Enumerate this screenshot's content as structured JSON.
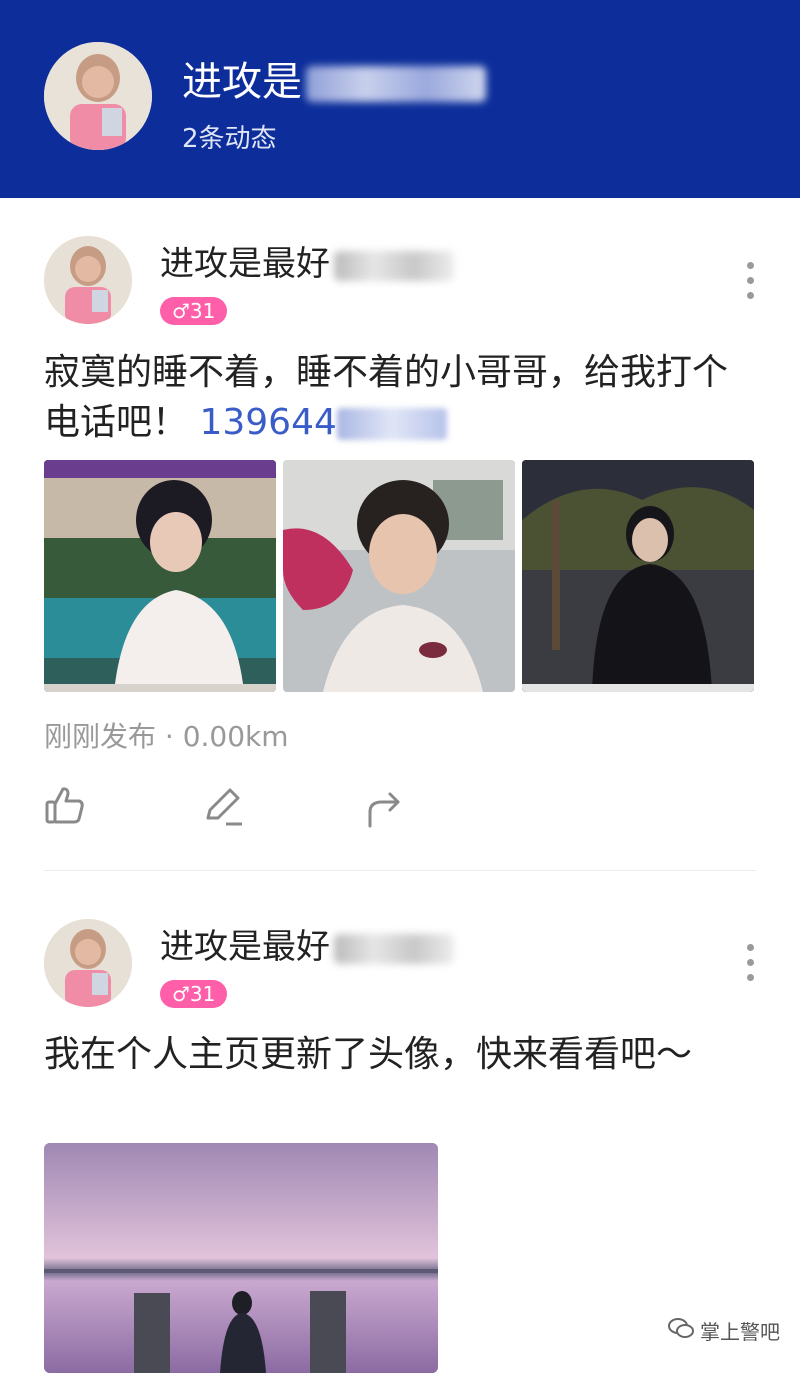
{
  "header": {
    "username": "进攻是",
    "post_count": "2条动态"
  },
  "posts": [
    {
      "author": "进攻是最好",
      "badge": "♂31",
      "text": "寂寞的睡不着，睡不着的小哥哥，给我打个电话吧！",
      "phone": "139644",
      "meta": "刚刚发布 · 0.00km"
    },
    {
      "author": "进攻是最好",
      "badge": "♂31",
      "text": "我在个人主页更新了头像，快来看看吧～"
    }
  ],
  "watermark": "掌上警吧",
  "colors": {
    "header_bg": "#0d2e9a",
    "badge_bg": "#ff5fa8",
    "phone_link": "#3a5cc7"
  }
}
